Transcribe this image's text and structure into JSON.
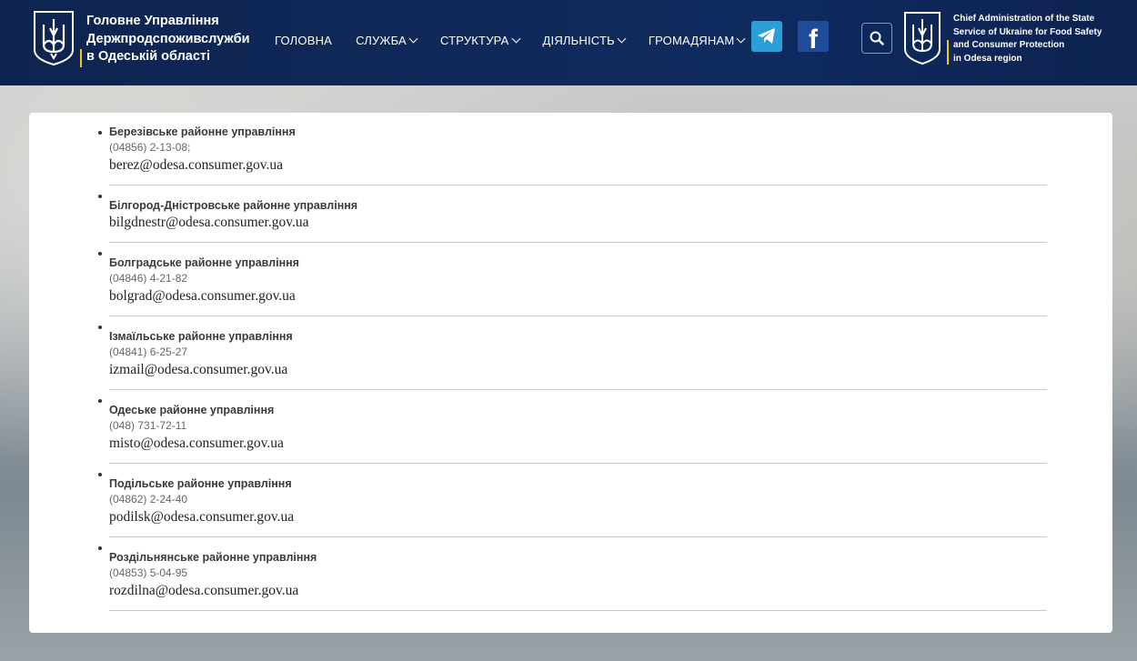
{
  "header": {
    "org_name_ua_line1": "Головне Управління",
    "org_name_ua_line2": "Держпродспоживслужби",
    "org_name_ua_line3": "в Одеській області",
    "org_name_en_line1": "Chief Administration of the State",
    "org_name_en_line2": "Service of Ukraine for Food Safety",
    "org_name_en_line3": "and Consumer Protection",
    "org_name_en_line4": "in Odesa region",
    "brand_accent_color": "#f5c518",
    "header_bg_color": "#0f2a5e"
  },
  "nav": [
    {
      "label": "ГОЛОВНА",
      "has_dropdown": false
    },
    {
      "label": "СЛУЖБА",
      "has_dropdown": true
    },
    {
      "label": "СТРУКТУРА",
      "has_dropdown": true
    },
    {
      "label": "ДІЯЛЬНІСТЬ",
      "has_dropdown": true
    },
    {
      "label": "ГРОМАДЯНАМ",
      "has_dropdown": true
    }
  ],
  "social": {
    "telegram_icon": "telegram-icon",
    "facebook_icon": "facebook-icon",
    "facebook_glyph": "f",
    "search_icon": "search-icon"
  },
  "offices": [
    {
      "name": "Березівське районне управління",
      "phone": "(04856) 2-13-08;",
      "email": "berez@odesa.consumer.gov.ua"
    },
    {
      "name": "Білгород-Дністровське районне управління",
      "phone": "",
      "email": "bilgdnestr@odesa.consumer.gov.ua"
    },
    {
      "name": "Болградське районне управління",
      "phone": "(04846) 4-21-82",
      "email": "bolgrad@odesa.consumer.gov.ua"
    },
    {
      "name": "Ізмаїльське районне управління",
      "phone": "(04841) 6-25-27",
      "email": "izmail@odesa.consumer.gov.ua"
    },
    {
      "name": "Одеське районне управління",
      "phone": "(048) 731-72-11",
      "email": "misto@odesa.consumer.gov.ua"
    },
    {
      "name": "Подільське районне управління",
      "phone": "(04862) 2-24-40",
      "email": "podilsk@odesa.consumer.gov.ua"
    },
    {
      "name": "Роздільнянське районне управління",
      "phone": "(04853) 5-04-95",
      "email": "rozdilna@odesa.consumer.gov.ua"
    }
  ]
}
